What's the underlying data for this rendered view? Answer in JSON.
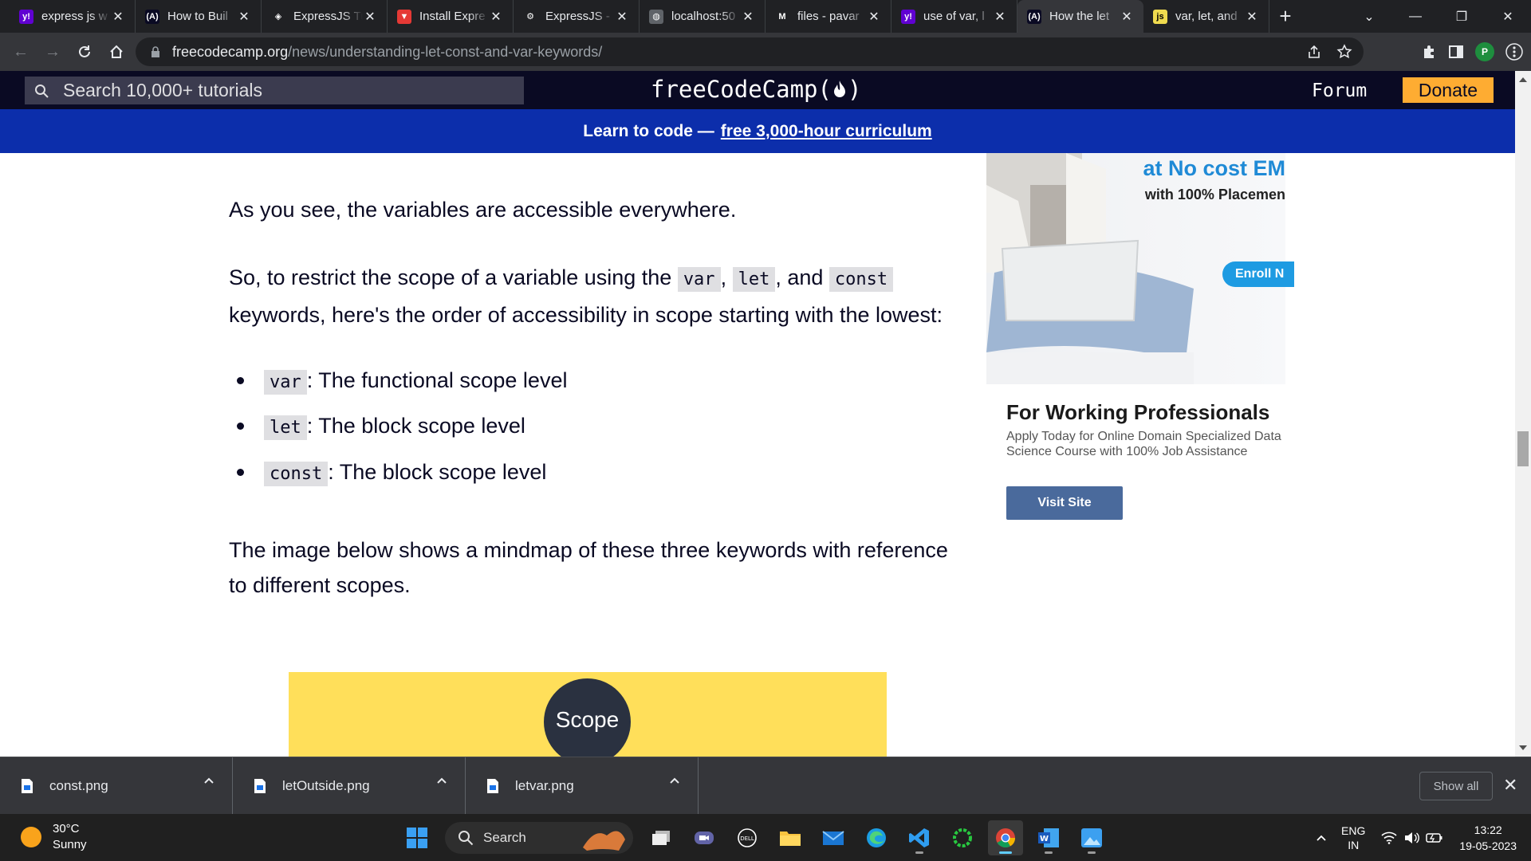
{
  "tabs": [
    {
      "title": "express js w",
      "favicon": "yahoo-icon",
      "favicon_color": "#6001d2",
      "favicon_text": "y!"
    },
    {
      "title": "How to Buil",
      "favicon": "freecodecamp-icon",
      "favicon_color": "#0a0a23",
      "favicon_text": "(A)"
    },
    {
      "title": "ExpressJS Tu",
      "favicon": "diamond-icon",
      "favicon_color": "#202124",
      "favicon_text": "◈"
    },
    {
      "title": "Install Expre",
      "favicon": "red-v-icon",
      "favicon_color": "#e53935",
      "favicon_text": "▼"
    },
    {
      "title": "ExpressJS -",
      "favicon": "gear-logo-icon",
      "favicon_color": "#202124",
      "favicon_text": "⚙"
    },
    {
      "title": "localhost:50",
      "favicon": "globe-icon",
      "favicon_color": "#5f6368",
      "favicon_text": "◍"
    },
    {
      "title": "files - pavar",
      "favicon": "gmail-icon",
      "favicon_color": "#202124",
      "favicon_text": "M"
    },
    {
      "title": "use of var, l",
      "favicon": "yahoo-icon",
      "favicon_color": "#6001d2",
      "favicon_text": "y!"
    },
    {
      "title": "How the let",
      "favicon": "freecodecamp-icon",
      "favicon_color": "#0a0a23",
      "favicon_text": "(A)",
      "active": true
    },
    {
      "title": "var, let, and",
      "favicon": "js-icon",
      "favicon_color": "#f0db4f",
      "favicon_text": "js"
    }
  ],
  "address": {
    "domain": "freecodecamp.org",
    "path": "/news/understanding-let-const-and-var-keywords/"
  },
  "fcc": {
    "search_placeholder": "Search 10,000+ tutorials",
    "logo": "freeCodeCamp(",
    "logo_close": ")",
    "forum": "Forum",
    "donate": "Donate",
    "banner_text": "Learn to code —",
    "banner_link": "free 3,000-hour curriculum"
  },
  "article": {
    "p1": "As you see, the variables are accessible everywhere.",
    "p2_a": "So, to restrict the scope of a variable using the ",
    "p2_var": "var",
    "p2_comma": ", ",
    "p2_let": "let",
    "p2_and": ", and ",
    "p2_const": "const",
    "p2_b": "keywords, here's the order of accessibility in scope starting with the lowest:",
    "bullets": [
      {
        "code": "var",
        "text": ": The functional scope level"
      },
      {
        "code": "let",
        "text": ": The block scope level"
      },
      {
        "code": "const",
        "text": ": The block scope level"
      }
    ],
    "p3": "The image below shows a mindmap of these three keywords with reference to different scopes.",
    "mindmap_root": "Scope"
  },
  "ad": {
    "headline": "at No cost EM",
    "sub": "with 100% Placemen",
    "enroll": "Enroll N",
    "title": "For Working Professionals",
    "desc": "Apply Today for Online Domain Specialized Data Science Course with 100% Job Assistance",
    "cta": "Visit Site"
  },
  "downloads": {
    "items": [
      "const.png",
      "letOutside.png",
      "letvar.png"
    ],
    "show_all": "Show all"
  },
  "taskbar": {
    "temp": "30°C",
    "weather": "Sunny",
    "search": "Search",
    "lang1": "ENG",
    "lang2": "IN",
    "time": "13:22",
    "date": "19-05-2023"
  }
}
